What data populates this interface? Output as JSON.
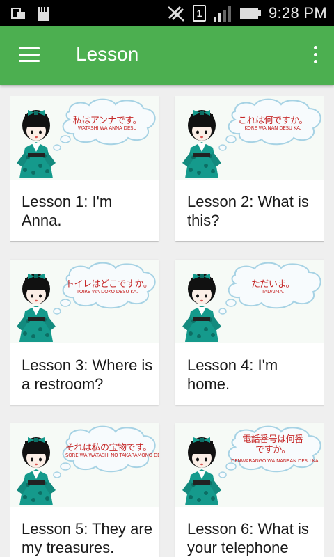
{
  "status_bar": {
    "time": "9:28 PM",
    "sim_slot": "1"
  },
  "app_bar": {
    "title": "Lesson"
  },
  "lessons": [
    {
      "title": "Lesson 1: I'm Anna.",
      "bubble_jp": "私はアンナです。",
      "bubble_romaji": "WATASHI WA ANNA DESU"
    },
    {
      "title": "Lesson 2: What is this?",
      "bubble_jp": "これは何ですか。",
      "bubble_romaji": "KORE WA NAN DESU KA."
    },
    {
      "title": "Lesson 3: Where is a restroom?",
      "bubble_jp": "トイレはどこですか。",
      "bubble_romaji": "TOIRE WA DOKO DESU KA."
    },
    {
      "title": "Lesson 4: I'm home.",
      "bubble_jp": "ただいま。",
      "bubble_romaji": "TADAIMA."
    },
    {
      "title": "Lesson 5: They are my treasures.",
      "bubble_jp": "それは私の宝物です。",
      "bubble_romaji": "SORE WA WATASHI NO TAKARAMONO DESU"
    },
    {
      "title": "Lesson 6: What is your telephone",
      "bubble_jp": "電話番号は何番ですか。",
      "bubble_romaji": "DENWABANGO WA NANBAN DESU KA."
    }
  ],
  "colors": {
    "app_bar": "#4caf50",
    "status_bar": "#000000",
    "kimono": "#159a8c",
    "bubble_text": "#c62828"
  },
  "icons": [
    "menu-icon",
    "more-vert-icon",
    "wifi-off-icon",
    "signal-icon",
    "battery-icon",
    "sd-card-icon",
    "notification-icon"
  ]
}
